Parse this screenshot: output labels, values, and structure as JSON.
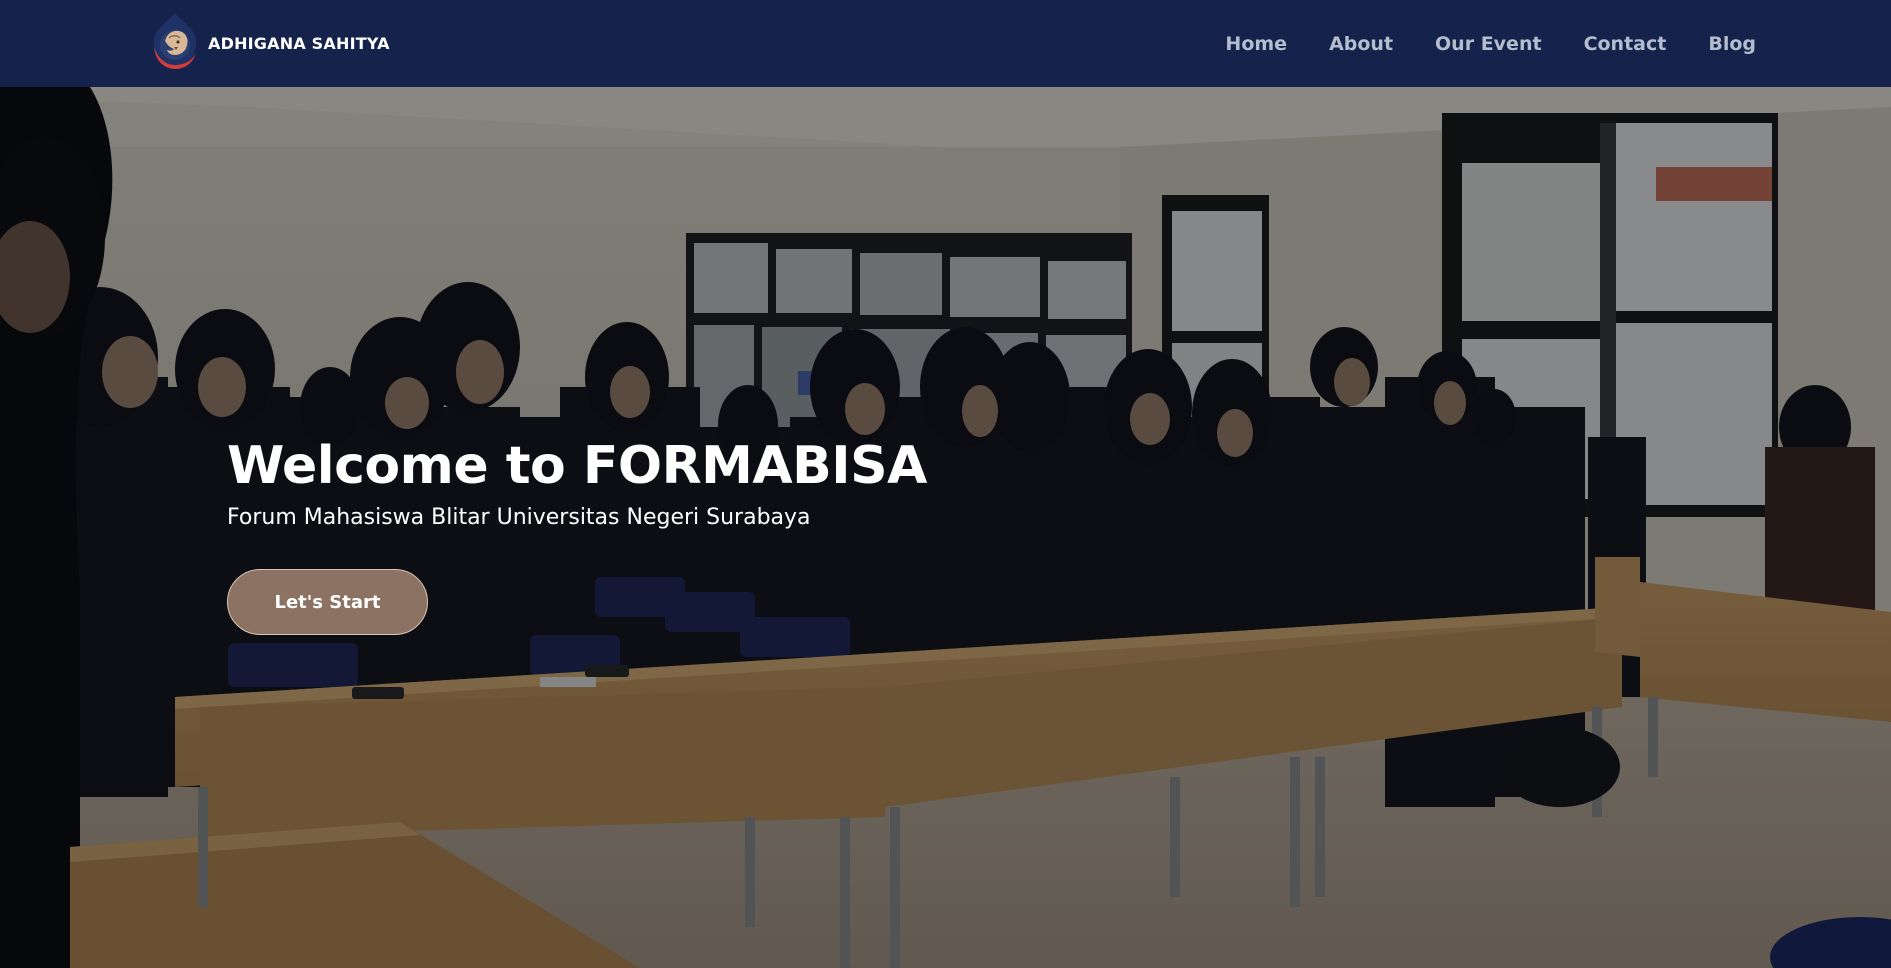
{
  "navbar": {
    "brand": {
      "logo_icon": "lion-head-icon",
      "name": "ADHIGANA SAHITYA"
    },
    "links": [
      {
        "label": "Home"
      },
      {
        "label": "About"
      },
      {
        "label": "Our Event"
      },
      {
        "label": "Contact"
      },
      {
        "label": "Blog"
      }
    ],
    "colors": {
      "background": "#15234c",
      "link": "#b4bccd"
    }
  },
  "hero": {
    "title": "Welcome to FORMABISA",
    "subtitle": "Forum Mahasiswa Blitar Universitas Negeri Surabaya",
    "cta_label": "Let's Start",
    "photo_icon": "classroom-group-photo",
    "colors": {
      "cta": "#8c7262",
      "cta_border": "#d8c4b3"
    }
  }
}
